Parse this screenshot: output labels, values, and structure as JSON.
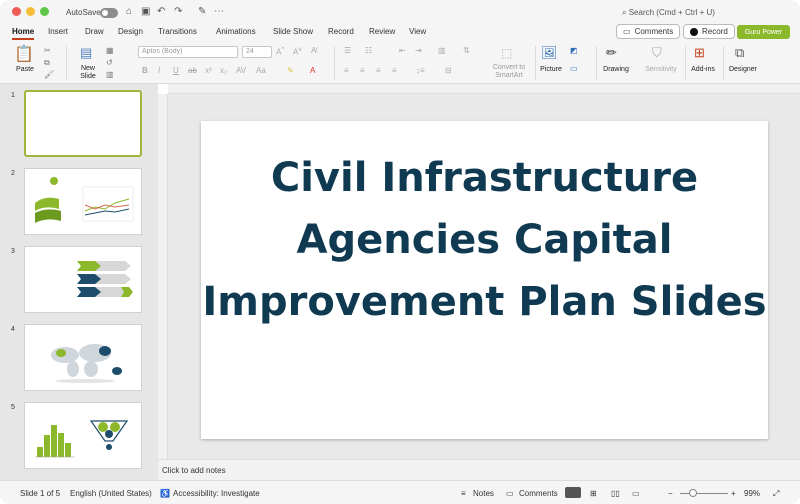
{
  "titlebar": {
    "autosave": "AutoSave",
    "search": "Search (Cmd + Ctrl + U)"
  },
  "tabs": [
    "Home",
    "Insert",
    "Draw",
    "Design",
    "Transitions",
    "Animations",
    "Slide Show",
    "Record",
    "Review",
    "View"
  ],
  "actions": {
    "comments": "Comments",
    "record": "Record",
    "guru": "Guru Power"
  },
  "ribbon": {
    "paste": "Paste",
    "new_slide": "New Slide",
    "font_name": "Aptos (Body)",
    "font_size": "24",
    "convert": "Convert to SmartArt",
    "picture": "Picture",
    "drawing": "Drawing",
    "sensitivity": "Sensitivity",
    "addins": "Add-ins",
    "designer": "Designer"
  },
  "slides": [
    {
      "num": "1"
    },
    {
      "num": "2"
    },
    {
      "num": "3"
    },
    {
      "num": "4"
    },
    {
      "num": "5"
    }
  ],
  "slide": {
    "title": "Civil Infrastructure Agencies Capital Improvement Plan Slides"
  },
  "notes": "Click to add notes",
  "status": {
    "slide": "Slide 1 of 5",
    "lang": "English (United States)",
    "access": "Accessibility: Investigate",
    "notes": "Notes",
    "comments": "Comments",
    "zoom": "99%"
  },
  "colors": {
    "accent": "#c43e1c",
    "title": "#0f3a52",
    "green": "#8cb82b"
  }
}
